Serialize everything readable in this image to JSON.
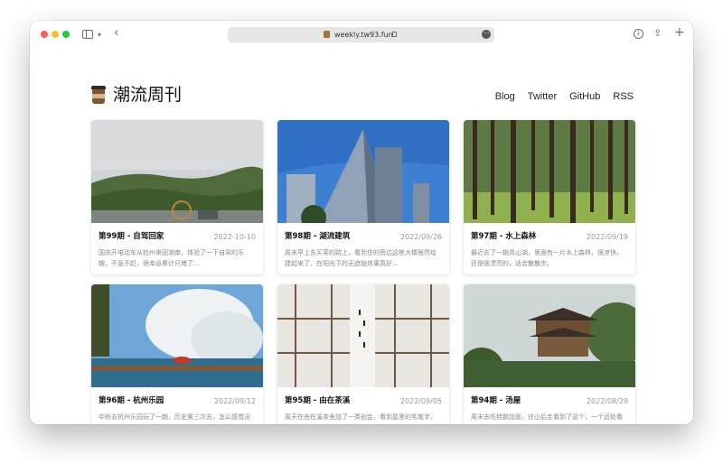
{
  "browser": {
    "url": "weekly.tw93.fun",
    "icons": [
      "sidebar-icon",
      "chevron-down-icon",
      "back-icon",
      "lock-icon",
      "more-icon",
      "download-icon",
      "share-icon",
      "plus-icon"
    ]
  },
  "site": {
    "title": "潮流周刊",
    "logo": "coffee-cup-icon",
    "nav": [
      "Blog",
      "Twitter",
      "GitHub",
      "RSS"
    ]
  },
  "cards": [
    {
      "title": "第99期 - 自驾回家",
      "date": "2022-10-10",
      "desc": "国庆开电动车从杭州来回湖南，体验了一下自驾的乐趣，不急不赶，很幸运累计只堵了…"
    },
    {
      "title": "第98期 - 湖流建筑",
      "date": "2022/09/26",
      "desc": "周末早上去买菜的路上，看到住的旁边这栋大楼居然给建起来了，在阳光下的无遮拢效果真好…"
    },
    {
      "title": "第97期 - 水上森林",
      "date": "2022/09/19",
      "desc": "最近去了一趟青山湖，里面有一片水上森林，很凉快，还是很漂亮的，适合散散步。"
    },
    {
      "title": "第96期 - 杭州乐园",
      "date": "2022/09/12",
      "desc": "中秋去杭州乐园玩了一趟，历史第三次去，怎么感觉没有上两次新鲜了，除去这个水还可以，…"
    },
    {
      "title": "第95期 - 由在茶溪",
      "date": "2022/09/05",
      "desc": "周天在由在溪茶舍加了一类创会，看到屋里的毛笔字，挺美的，居然是老板自己写的，牛的。"
    },
    {
      "title": "第94期 - 汤屋",
      "date": "2022/08/29",
      "desc": "周末去吃桂鹏加面，往山后走看到了这个，一个远处看很有感觉的建筑，查了查叫汤屋。"
    }
  ],
  "colors": {
    "close": "#ff5f57",
    "minimize": "#febc2e",
    "maximize": "#28c840"
  }
}
